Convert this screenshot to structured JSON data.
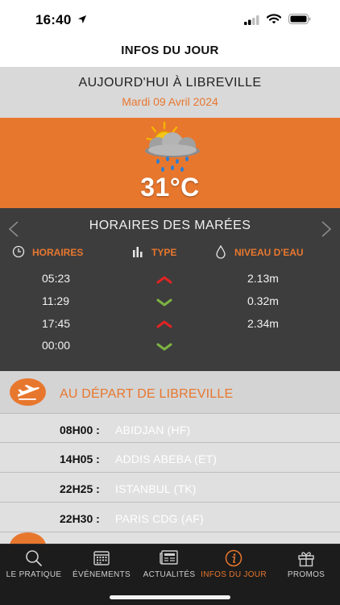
{
  "status_bar": {
    "time": "16:40"
  },
  "header": {
    "title": "INFOS DU JOUR"
  },
  "today": {
    "title": "AUJOURD'HUI À LIBREVILLE",
    "date": "Mardi 09 Avril 2024"
  },
  "weather": {
    "icon": "partly-cloudy-rain-icon",
    "temperature": "31°C"
  },
  "tides": {
    "title": "HORAIRES DES MARÉES",
    "columns": {
      "time": "HORAIRES",
      "type": "TYPE",
      "level": "NIVEAU D'EAU"
    },
    "rows": [
      {
        "time": "05:23",
        "type": "up",
        "level": "2.13m"
      },
      {
        "time": "11:29",
        "type": "down",
        "level": "0.32m"
      },
      {
        "time": "17:45",
        "type": "up",
        "level": "2.34m"
      },
      {
        "time": "00:00",
        "type": "down",
        "level": ""
      }
    ]
  },
  "departures": {
    "title": "AU DÉPART DE LIBREVILLE",
    "flights": [
      {
        "time": "08H00 :",
        "destination": "ABIDJAN (HF)"
      },
      {
        "time": "14H05 :",
        "destination": "ADDIS ABEBA (ET)"
      },
      {
        "time": "22H25 :",
        "destination": "ISTANBUL (TK)"
      },
      {
        "time": "22H30 :",
        "destination": "PARIS CDG (AF)"
      }
    ]
  },
  "tabs": [
    {
      "label": "LE PRATIQUE",
      "icon": "search-icon",
      "active": false
    },
    {
      "label": "ÉVÉNEMENTS",
      "icon": "calendar-icon",
      "active": false
    },
    {
      "label": "ACTUALITÉS",
      "icon": "newspaper-icon",
      "active": false
    },
    {
      "label": "INFOS DU JOUR",
      "icon": "info-icon",
      "active": true
    },
    {
      "label": "PROMOS",
      "icon": "gift-icon",
      "active": false
    }
  ],
  "colors": {
    "accent": "#e8772e",
    "tide_up": "#e02424",
    "tide_down": "#7cb342",
    "tides_bg": "#3d3d3d",
    "tab_bar_bg": "#1c1c1c"
  }
}
